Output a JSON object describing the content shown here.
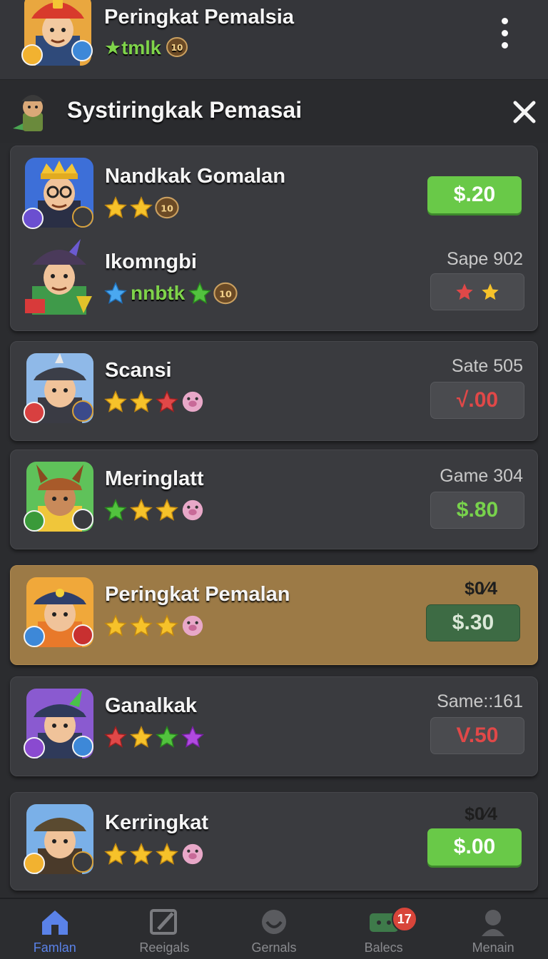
{
  "header": {
    "title": "Peringkat Pemalsia",
    "subtitle": "tmlk",
    "avatar_icon": "firefighter-avatar",
    "menu_icon": "more-vertical-icon"
  },
  "panel": {
    "title": "Systiringkak Pemasai",
    "close_icon": "close-icon"
  },
  "rows": [
    {
      "name": "Nandkak Gomalan",
      "score": "",
      "price": "$.20",
      "stars": [
        "yellow",
        "yellow",
        "coin"
      ],
      "style": "green",
      "status_text": ""
    },
    {
      "name": "Ikomngbi",
      "score": "Sape 902",
      "price": "",
      "stars": [
        "blue"
      ],
      "badge_text": "nnbtk",
      "style": "dark",
      "mini_stars": [
        "red",
        "yellow"
      ]
    },
    {
      "name": "Scansi",
      "score": "Sate 505",
      "price": "√.00",
      "stars": [
        "yellow",
        "yellow",
        "red",
        "pig"
      ],
      "style": "dark-red"
    },
    {
      "name": "Meringlatt",
      "score": "Game 304",
      "price": "$.80",
      "stars": [
        "green",
        "yellow",
        "yellow",
        "pig"
      ],
      "style": "dark-green"
    },
    {
      "name": "Peringkat Pemalan",
      "score": "$0⁄4",
      "price": "$.30",
      "stars": [
        "yellow",
        "yellow",
        "yellow",
        "pig"
      ],
      "style": "moss"
    },
    {
      "name": "Ganalkak",
      "score": "Same::161",
      "price": "V.50",
      "stars": [
        "red",
        "yellow",
        "green",
        "purple"
      ],
      "style": "dark-red"
    },
    {
      "name": "Kerringkat",
      "score": "$0⁄4",
      "price": "$.00",
      "stars": [
        "yellow",
        "yellow",
        "yellow",
        "pig"
      ],
      "style": "green"
    }
  ],
  "nav": [
    {
      "label": "Famlan",
      "icon": "home-icon",
      "active": true
    },
    {
      "label": "Reeigals",
      "icon": "edit-icon",
      "active": false
    },
    {
      "label": "Gernals",
      "icon": "globe-icon",
      "active": false
    },
    {
      "label": "Balecs",
      "icon": "chat-icon",
      "active": false,
      "badge": "17"
    },
    {
      "label": "Menain",
      "icon": "profile-icon",
      "active": false
    }
  ],
  "colors": {
    "background": "#2b2c2f",
    "card": "#3a3b3f",
    "highlight": "#9c7a46",
    "green_button": "#69c948",
    "accent_blue": "#5a82e8",
    "negative": "#e04848",
    "positive": "#78d24c"
  }
}
